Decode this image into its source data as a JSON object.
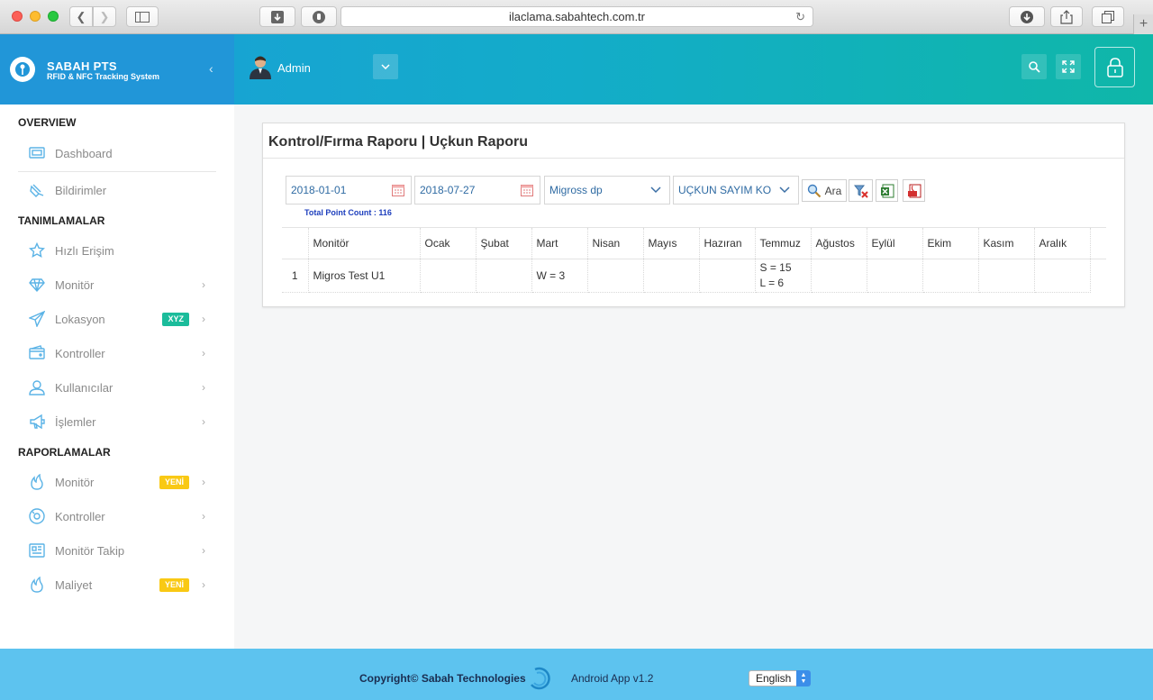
{
  "browser": {
    "url": "ilaclama.sabahtech.com.tr"
  },
  "header": {
    "brand_title": "SABAH PTS",
    "brand_subtitle": "RFID & NFC Tracking System",
    "user_name": "Admin"
  },
  "sidebar": {
    "overview_title": "OVERVIEW",
    "dashboard": "Dashboard",
    "bildirimler": "Bildirimler",
    "tanimlamalar_title": "TANIMLAMALAR",
    "tanim_items": [
      {
        "label": "Hızlı Erişim"
      },
      {
        "label": "Monitör"
      },
      {
        "label": "Lokasyon",
        "badge": "XYZ"
      },
      {
        "label": "Kontroller"
      },
      {
        "label": "Kullanıcılar"
      },
      {
        "label": "İşlemler"
      }
    ],
    "raporlamalar_title": "RAPORLAMALAR",
    "rapor_items": [
      {
        "label": "Monitör",
        "badge": "YENİ"
      },
      {
        "label": "Kontroller"
      },
      {
        "label": "Monitör Takip"
      },
      {
        "label": "Maliyet",
        "badge": "YENİ"
      }
    ]
  },
  "report": {
    "title": "Kontrol/Fırma Raporu | Uçkun Raporu",
    "start_date": "2018-01-01",
    "end_date": "2018-07-27",
    "company": "Migross dp",
    "report_type": "UÇKUN SAYIM KO",
    "search_label": "Ara",
    "total_label": "Total Point Count : 116",
    "columns": [
      "",
      "Monitör",
      "Ocak",
      "Şubat",
      "Mart",
      "Nisan",
      "Mayıs",
      "Hazıran",
      "Temmuz",
      "Ağustos",
      "Eylül",
      "Ekim",
      "Kasım",
      "Aralık"
    ],
    "rows": [
      {
        "num": "1",
        "monitor": "Migros Test U1",
        "ocak": "",
        "subat": "",
        "mart": "W = 3",
        "nisan": "",
        "mayis": "",
        "haziran": "",
        "temmuz_1": "S = 15",
        "temmuz_2": "L = 6",
        "agustos": "",
        "eylul": "",
        "ekim": "",
        "kasim": "",
        "aralik": ""
      }
    ]
  },
  "footer": {
    "copyright": "Copyright© Sabah Technologies",
    "android": "Android App v1.2",
    "language": "English"
  },
  "colors": {
    "header_gradient_start": "#1a9fd8",
    "header_gradient_end": "#0fb7a8",
    "brand_bg": "#2196d8",
    "footer_bg": "#5dc3ef",
    "badge_green": "#1bbc9b",
    "badge_yellow": "#f9c914",
    "icon_blue": "#5bb3e6"
  }
}
